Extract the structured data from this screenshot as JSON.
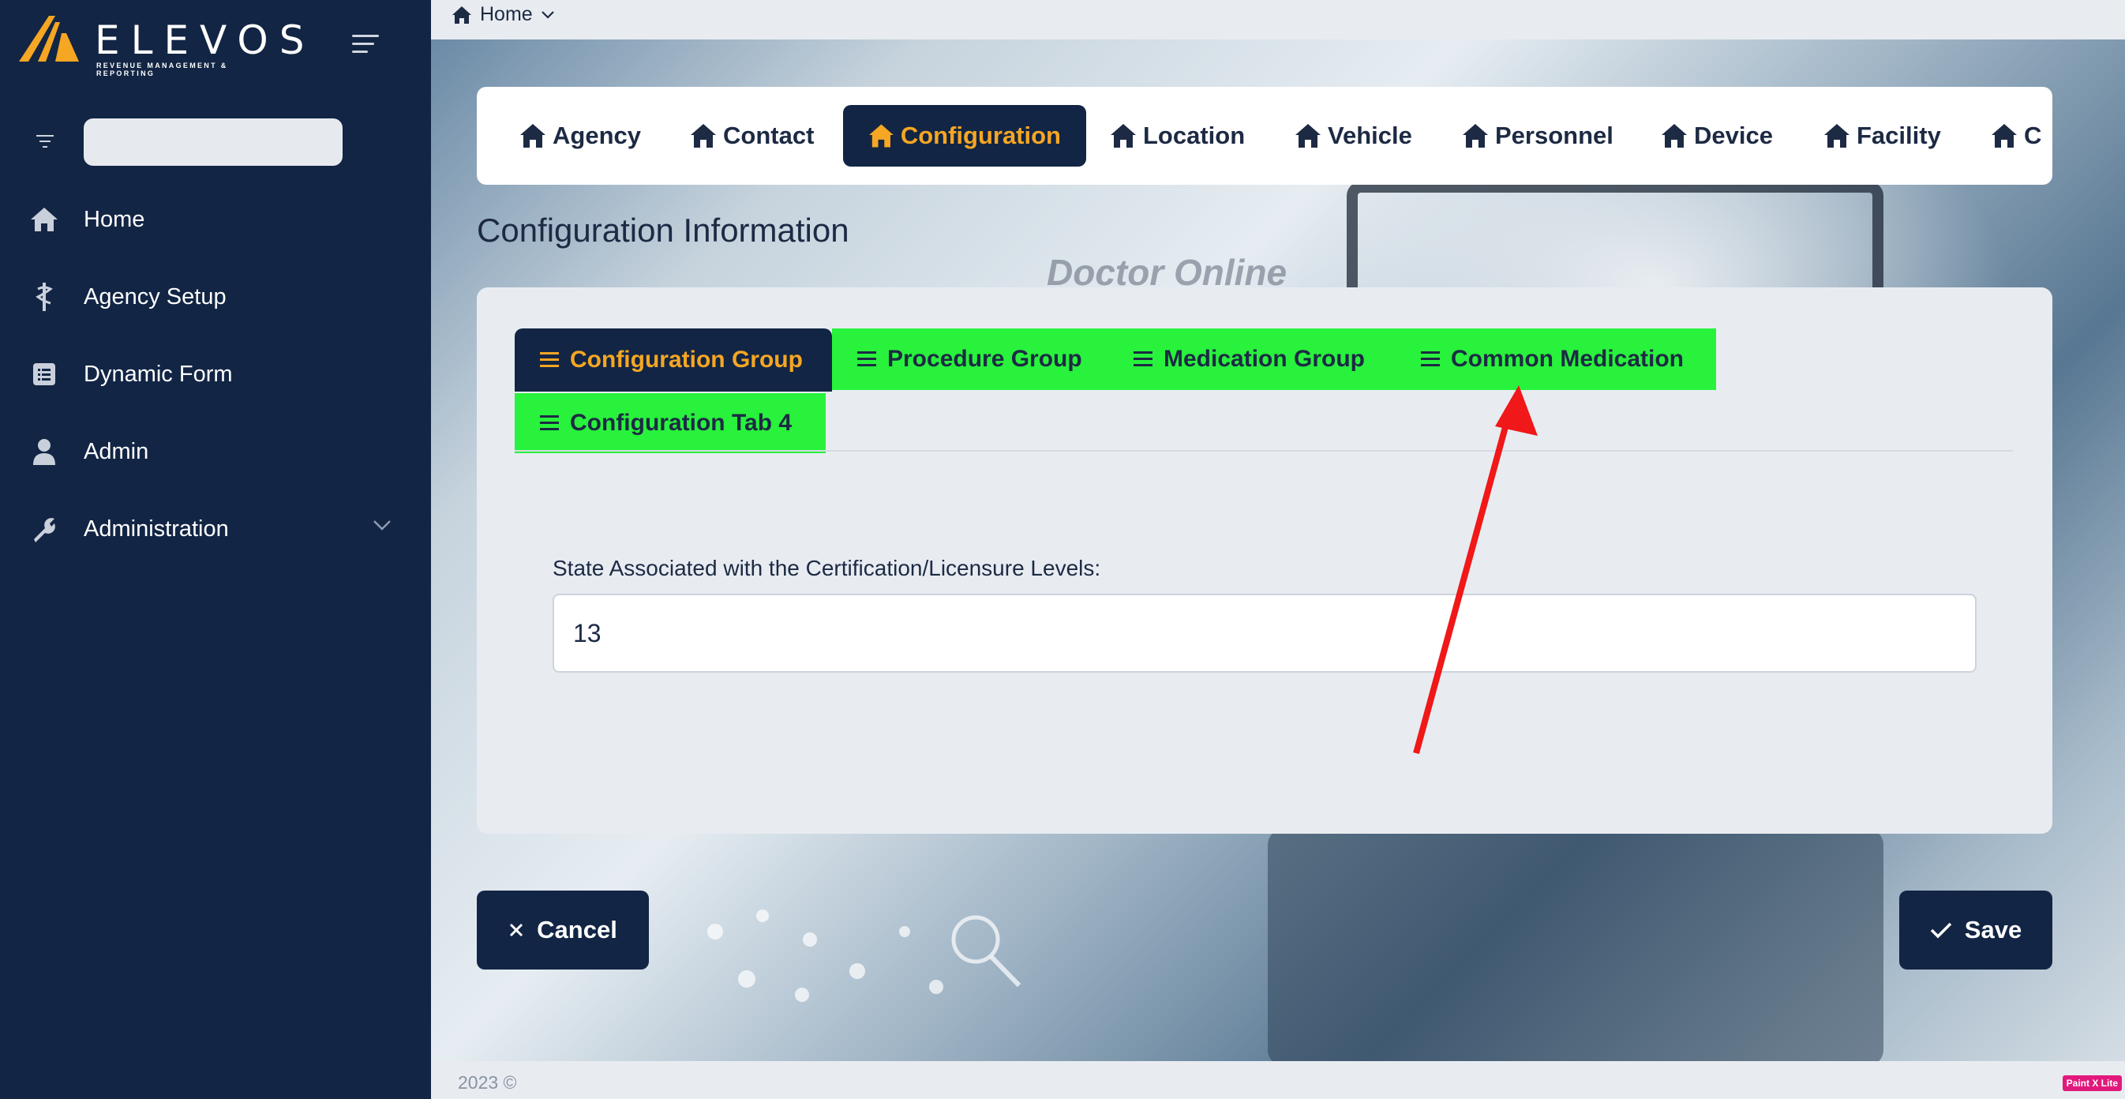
{
  "brand": {
    "name": "ELEVOS",
    "tagline": "REVENUE MANAGEMENT & REPORTING"
  },
  "sidebar": {
    "search_placeholder": "",
    "items": [
      {
        "label": "Home",
        "icon": "home-icon"
      },
      {
        "label": "Agency Setup",
        "icon": "caduceus-icon"
      },
      {
        "label": "Dynamic Form",
        "icon": "form-icon"
      },
      {
        "label": "Admin",
        "icon": "user-icon"
      },
      {
        "label": "Administration",
        "icon": "wrench-icon",
        "has_submenu": true
      }
    ]
  },
  "breadcrumb": {
    "label": "Home"
  },
  "top_tabs": [
    {
      "label": "Agency"
    },
    {
      "label": "Contact"
    },
    {
      "label": "Configuration",
      "active": true
    },
    {
      "label": "Location"
    },
    {
      "label": "Vehicle"
    },
    {
      "label": "Personnel"
    },
    {
      "label": "Device"
    },
    {
      "label": "Facility"
    },
    {
      "label": "C"
    }
  ],
  "page_title": "Configuration Information",
  "background_text": "Doctor Online",
  "config_tabs": [
    {
      "label": "Configuration Group",
      "active": true
    },
    {
      "label": "Procedure Group"
    },
    {
      "label": "Medication Group"
    },
    {
      "label": "Common Medication"
    },
    {
      "label": "Configuration Tab 4"
    }
  ],
  "form": {
    "state_field": {
      "label": "State Associated with the Certification/Licensure Levels:",
      "value": "13"
    }
  },
  "buttons": {
    "cancel": "Cancel",
    "save": "Save"
  },
  "footer": {
    "text": "2023 ©",
    "badge": "Paint X Lite"
  },
  "colors": {
    "sidebar_bg": "#122544",
    "accent": "#f5a623",
    "tab_green": "#28f23c",
    "annotation_arrow": "#f01818"
  }
}
